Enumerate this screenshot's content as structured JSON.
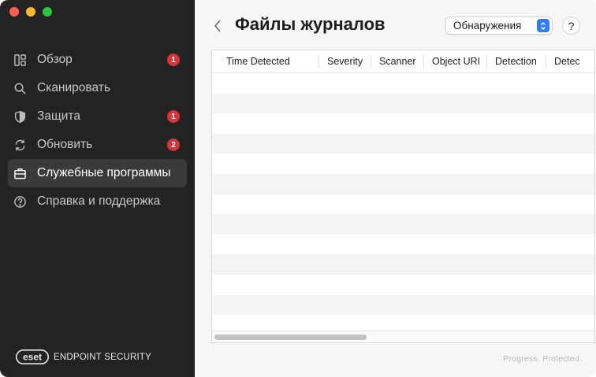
{
  "sidebar": {
    "items": [
      {
        "label": "Обзор",
        "icon": "overview-icon",
        "badge": "1",
        "active": false
      },
      {
        "label": "Сканировать",
        "icon": "search-icon",
        "badge": "",
        "active": false
      },
      {
        "label": "Защита",
        "icon": "shield-icon",
        "badge": "1",
        "active": false
      },
      {
        "label": "Обновить",
        "icon": "refresh-icon",
        "badge": "2",
        "active": false
      },
      {
        "label": "Служебные программы",
        "icon": "briefcase-icon",
        "badge": "",
        "active": true
      },
      {
        "label": "Справка и поддержка",
        "icon": "help-icon",
        "badge": "",
        "active": false
      }
    ],
    "brand_logo": "eset",
    "brand_text": "ENDPOINT SECURITY"
  },
  "main": {
    "title": "Файлы журналов",
    "select_value": "Обнаружения",
    "help_label": "?",
    "tagline": "Progress. Protected."
  },
  "table": {
    "columns": [
      "Time Detected",
      "Severity",
      "Scanner",
      "Object URI",
      "Detection",
      "Detec"
    ],
    "rows": []
  },
  "colors": {
    "sidebar_bg": "#232323",
    "badge": "#d3363a",
    "accent": "#2f7cf6"
  }
}
